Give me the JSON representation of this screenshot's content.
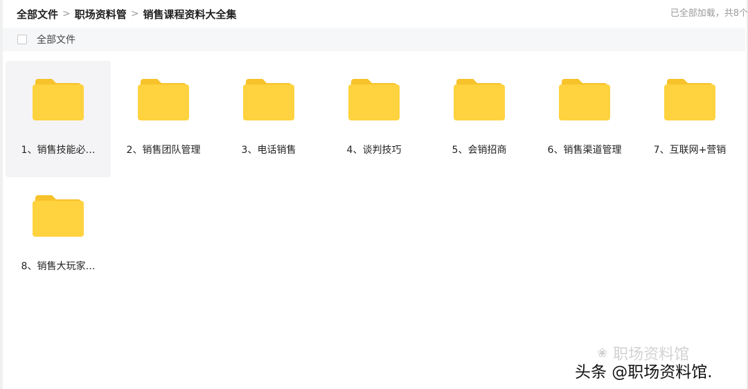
{
  "breadcrumb": {
    "items": [
      "全部文件",
      "职场资料管",
      "销售课程资料大全集"
    ],
    "separator": ">"
  },
  "status_text": "已全部加载，共8个",
  "select_all_label": "全部文件",
  "colors": {
    "folder_body": "#FFD23F",
    "folder_tab": "#F7C22A",
    "hover_bg": "#f4f4f6"
  },
  "folders": [
    {
      "label": "1、销售技能必…",
      "icon": "folder-icon"
    },
    {
      "label": "2、销售团队管理",
      "icon": "folder-icon"
    },
    {
      "label": "3、电话销售",
      "icon": "folder-icon"
    },
    {
      "label": "4、谈判技巧",
      "icon": "folder-icon"
    },
    {
      "label": "5、会销招商",
      "icon": "folder-icon"
    },
    {
      "label": "6、销售渠道管理",
      "icon": "folder-icon"
    },
    {
      "label": "7、互联网+营销",
      "icon": "folder-icon"
    },
    {
      "label": "8、销售大玩家…",
      "icon": "folder-icon"
    }
  ],
  "watermark": {
    "light": "职场资料馆",
    "strong": "头条 @职场资料馆."
  }
}
